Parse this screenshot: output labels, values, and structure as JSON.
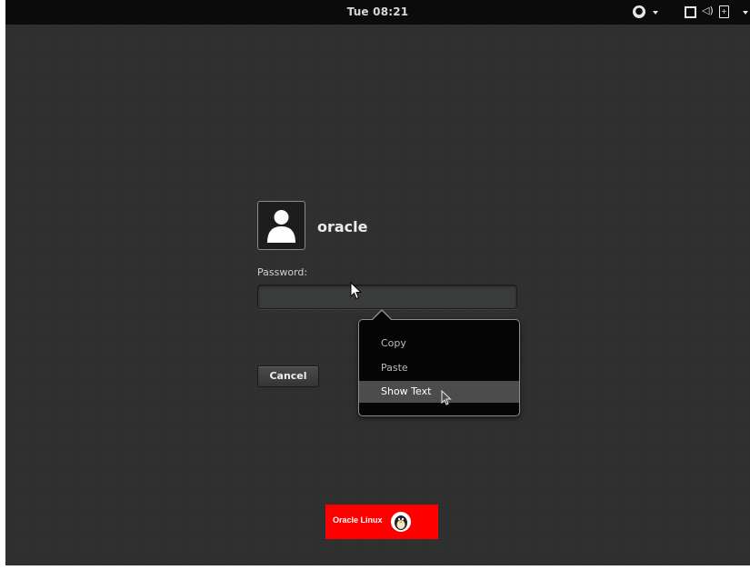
{
  "topbar": {
    "clock": "Tue 08:21",
    "icons": [
      "accessibility-icon",
      "window-icon",
      "volume-icon",
      "battery-icon"
    ]
  },
  "user": {
    "name": "oracle",
    "avatar_icon": "user-avatar-icon"
  },
  "login": {
    "password_label": "Password:",
    "password_value": "",
    "cancel_label": "Cancel"
  },
  "context_menu": {
    "items": [
      {
        "label": "Copy"
      },
      {
        "label": "Paste"
      },
      {
        "label": "Show Text",
        "highlighted": true
      }
    ]
  },
  "logo": {
    "text": "Oracle Linux"
  },
  "colors": {
    "background": "#2d2e2e",
    "topbar": "#0b0b0b",
    "menu_highlight": "#4b4c4c",
    "logo_bg": "#ff0000"
  }
}
